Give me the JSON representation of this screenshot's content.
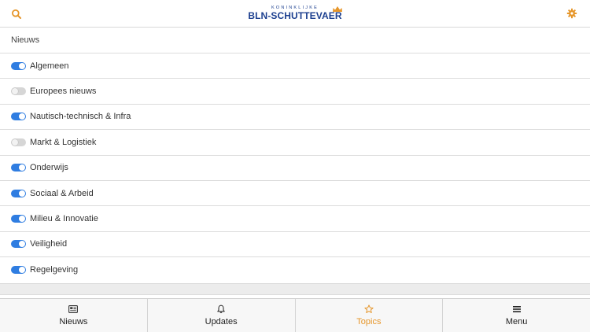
{
  "app": {
    "logo_small": "KONINKLIJKE",
    "logo_big": "BLN-SCHUTTEVAER",
    "accent": "#e6962a",
    "brand": "#1c3f8f",
    "toggle_on_color": "#2f7de1"
  },
  "header": {
    "search_icon": "search-icon",
    "settings_icon": "gear-icon"
  },
  "section": {
    "title": "Nieuws"
  },
  "topics": [
    {
      "label": "Algemeen",
      "enabled": true
    },
    {
      "label": "Europees nieuws",
      "enabled": false
    },
    {
      "label": "Nautisch-technisch & Infra",
      "enabled": true
    },
    {
      "label": "Markt & Logistiek",
      "enabled": false
    },
    {
      "label": "Onderwijs",
      "enabled": true
    },
    {
      "label": "Sociaal & Arbeid",
      "enabled": true
    },
    {
      "label": "Milieu & Innovatie",
      "enabled": true
    },
    {
      "label": "Veiligheid",
      "enabled": true
    },
    {
      "label": "Regelgeving",
      "enabled": true
    }
  ],
  "tabs": [
    {
      "label": "Nieuws",
      "icon": "newspaper-icon",
      "active": false
    },
    {
      "label": "Updates",
      "icon": "bell-icon",
      "active": false
    },
    {
      "label": "Topics",
      "icon": "star-icon",
      "active": true
    },
    {
      "label": "Menu",
      "icon": "hamburger-icon",
      "active": false
    }
  ]
}
